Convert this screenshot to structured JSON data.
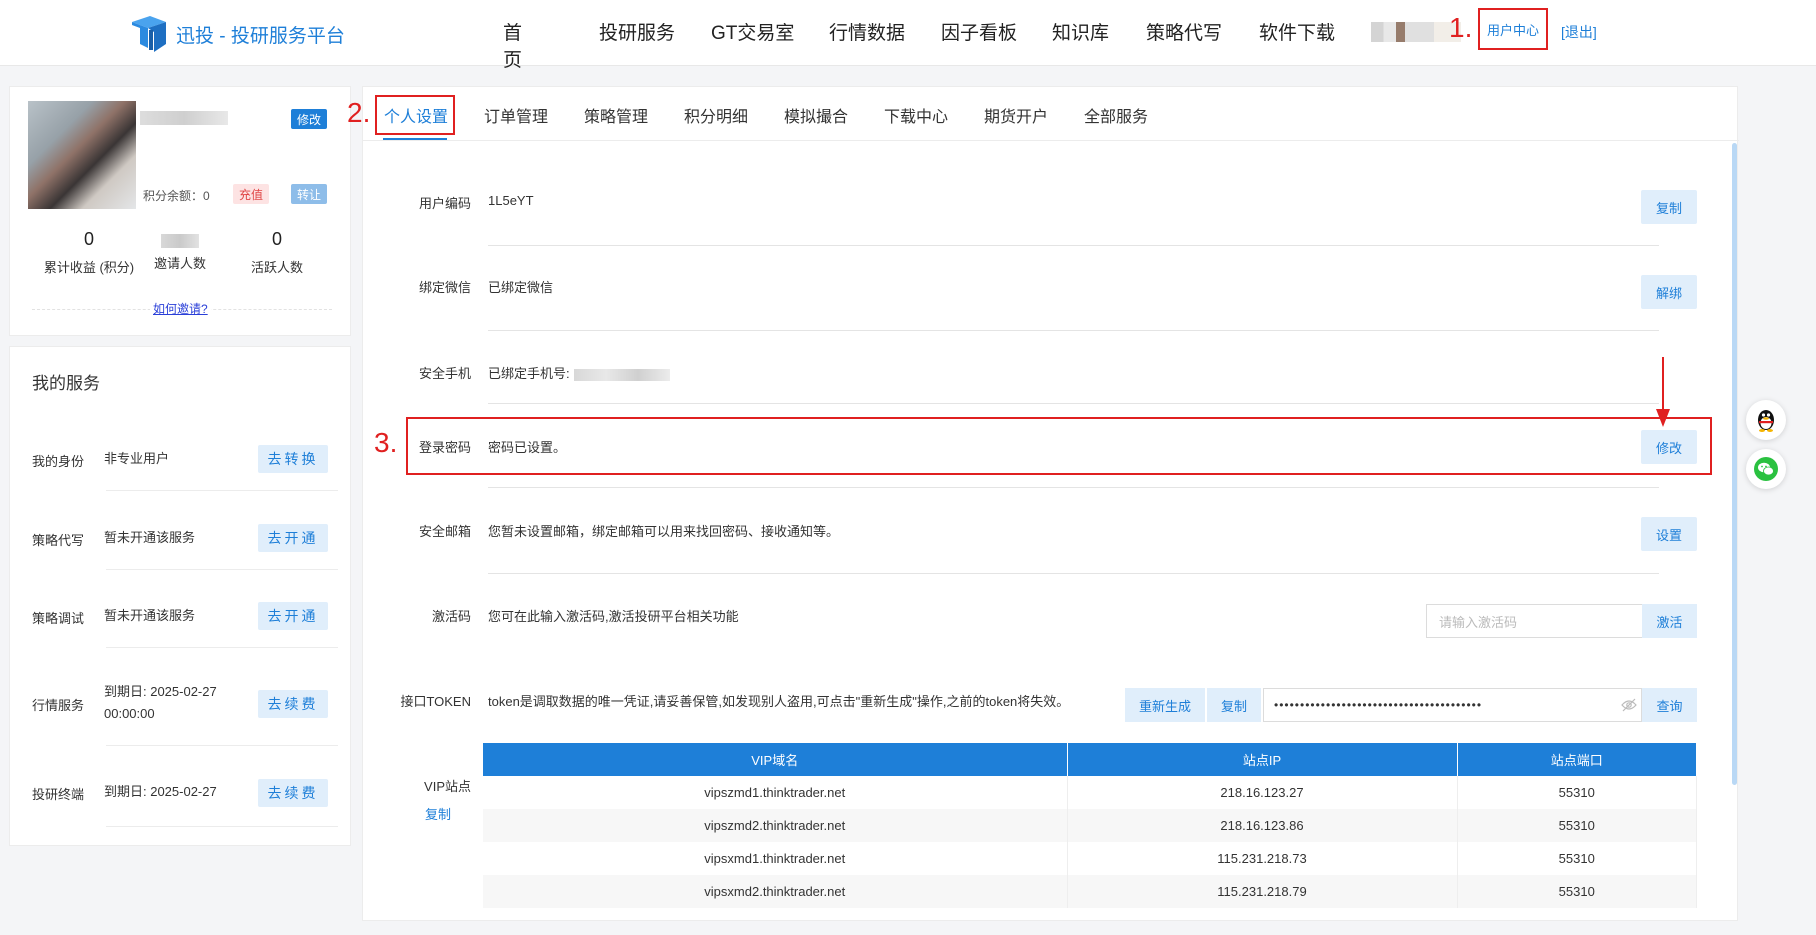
{
  "header": {
    "logo_text": "迅投 - 投研服务平台",
    "nav": [
      "首页",
      "投研服务",
      "GT交易室",
      "行情数据",
      "因子看板",
      "知识库",
      "策略代写",
      "软件下载"
    ],
    "user_center": "用户中心",
    "logout": "[退出]"
  },
  "annotations": {
    "a1": "1.",
    "a2": "2.",
    "a3": "3."
  },
  "profile": {
    "edit_label": "修改",
    "points_label": "积分余额：0",
    "recharge_label": "充值",
    "transfer_label": "转让",
    "stats": [
      {
        "value": "0",
        "label": "累计收益 (积分)"
      },
      {
        "value": "",
        "label": "邀请人数"
      },
      {
        "value": "0",
        "label": "活跃人数"
      }
    ],
    "invite_link": "如何邀请?"
  },
  "services": {
    "title": "我的服务",
    "rows": [
      {
        "label": "我的身份",
        "value": "非专业用户",
        "button": "去转换"
      },
      {
        "label": "策略代写",
        "value": "暂未开通该服务",
        "button": "去开通"
      },
      {
        "label": "策略调试",
        "value": "暂未开通该服务",
        "button": "去开通"
      },
      {
        "label": "行情服务",
        "value": "到期日: 2025-02-27",
        "value2": "00:00:00",
        "button": "去续费"
      },
      {
        "label": "投研终端",
        "value": "到期日: 2025-02-27",
        "button": "去续费"
      }
    ]
  },
  "tabs": [
    "个人设置",
    "订单管理",
    "策略管理",
    "积分明细",
    "模拟撮合",
    "下载中心",
    "期货开户",
    "全部服务"
  ],
  "settings": {
    "user_code": {
      "label": "用户编码",
      "value": "1L5eYT",
      "button": "复制"
    },
    "wechat": {
      "label": "绑定微信",
      "value": "已绑定微信",
      "button": "解绑"
    },
    "phone": {
      "label": "安全手机",
      "value": "已绑定手机号:"
    },
    "password": {
      "label": "登录密码",
      "value": "密码已设置。",
      "button": "修改"
    },
    "email": {
      "label": "安全邮箱",
      "value": "您暂未设置邮箱，绑定邮箱可以用来找回密码、接收通知等。",
      "button": "设置"
    },
    "activation": {
      "label": "激活码",
      "value": "您可在此输入激活码,激活投研平台相关功能",
      "placeholder": "请输入激活码",
      "button": "激活"
    },
    "token": {
      "label": "接口TOKEN",
      "value": "token是调取数据的唯一凭证,请妥善保管,如发现别人盗用,可点击\"重新生成\"操作,之前的token将失效。",
      "regen": "重新生成",
      "copy": "复制",
      "masked": "••••••••••••••••••••••••••••••••••••••••",
      "query": "查询"
    },
    "vip": {
      "label": "VIP站点",
      "copy": "复制",
      "headers": [
        "VIP域名",
        "站点IP",
        "站点端口"
      ],
      "rows": [
        [
          "vipszmd1.thinktrader.net",
          "218.16.123.27",
          "55310"
        ],
        [
          "vipszmd2.thinktrader.net",
          "218.16.123.86",
          "55310"
        ],
        [
          "vipsxmd1.thinktrader.net",
          "115.231.218.73",
          "55310"
        ],
        [
          "vipsxmd2.thinktrader.net",
          "115.231.218.79",
          "55310"
        ]
      ]
    }
  },
  "colors": {
    "accent": "#1e7fd8",
    "annotation": "#e02020"
  }
}
